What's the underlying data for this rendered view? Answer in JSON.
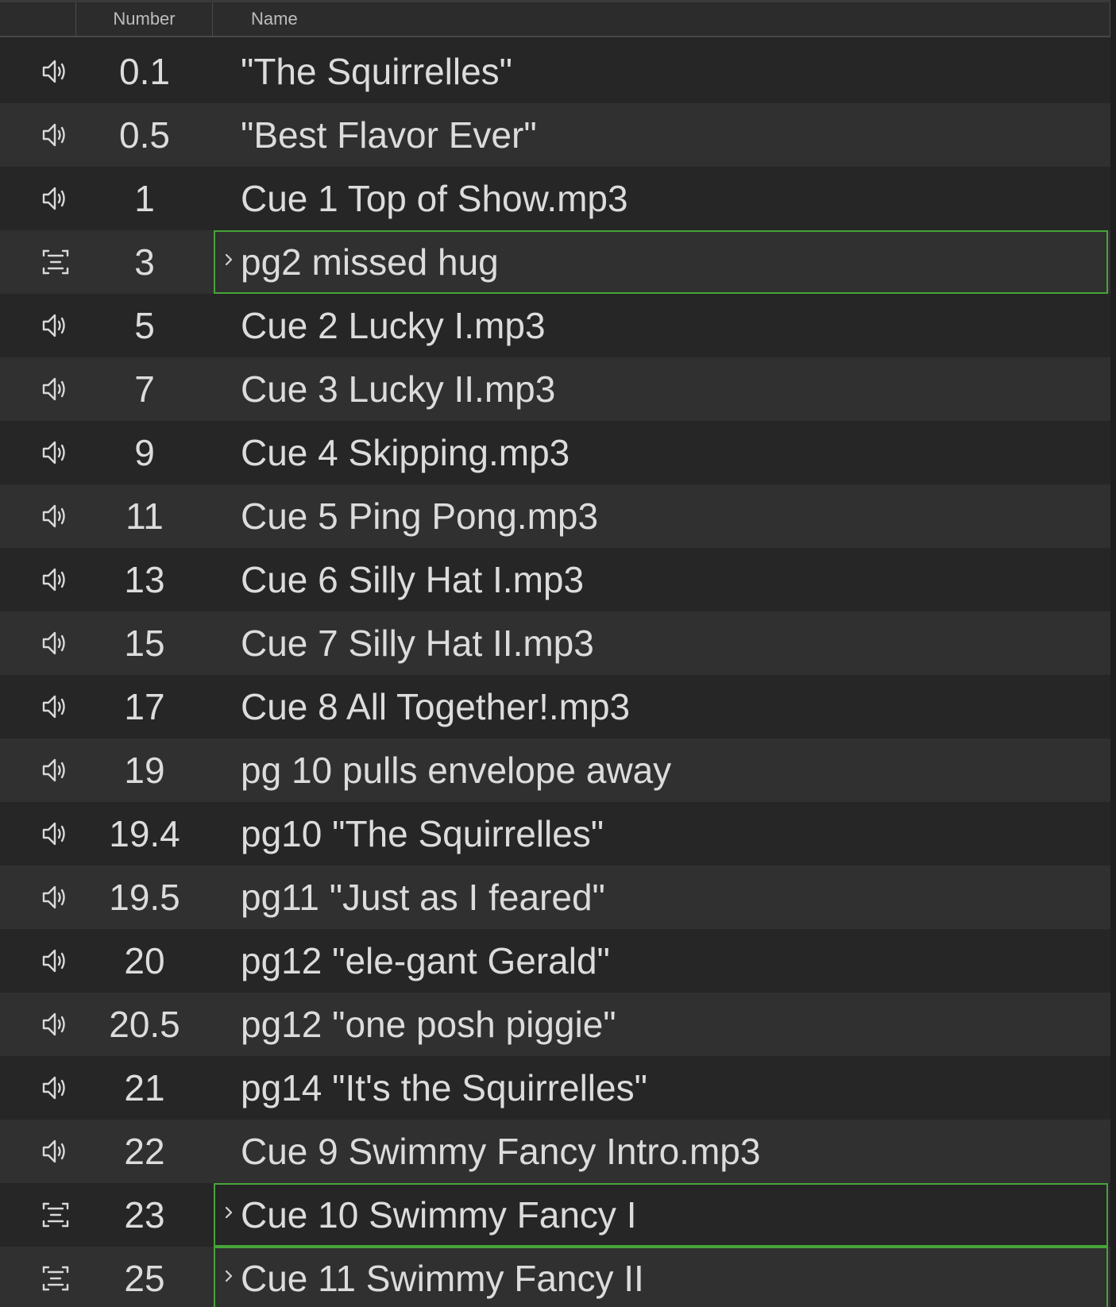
{
  "header": {
    "number_label": "Number",
    "name_label": "Name"
  },
  "colors": {
    "group_outline": "#47a33a",
    "row_dark": "#262626",
    "row_light": "#303030",
    "text": "#dcdcdc"
  },
  "cues": [
    {
      "type": "audio",
      "icon": "speaker-icon",
      "number": "0.1",
      "name": "\"The Squirrelles\""
    },
    {
      "type": "audio",
      "icon": "speaker-icon",
      "number": "0.5",
      "name": "\"Best Flavor Ever\""
    },
    {
      "type": "audio",
      "icon": "speaker-icon",
      "number": "1",
      "name": "Cue 1 Top of Show.mp3"
    },
    {
      "type": "group",
      "icon": "group-icon",
      "number": "3",
      "name": "pg2 missed hug"
    },
    {
      "type": "audio",
      "icon": "speaker-icon",
      "number": "5",
      "name": "Cue 2 Lucky I.mp3"
    },
    {
      "type": "audio",
      "icon": "speaker-icon",
      "number": "7",
      "name": "Cue 3 Lucky II.mp3"
    },
    {
      "type": "audio",
      "icon": "speaker-icon",
      "number": "9",
      "name": "Cue 4 Skipping.mp3"
    },
    {
      "type": "audio",
      "icon": "speaker-icon",
      "number": "11",
      "name": "Cue 5 Ping Pong.mp3"
    },
    {
      "type": "audio",
      "icon": "speaker-icon",
      "number": "13",
      "name": "Cue 6 Silly Hat I.mp3"
    },
    {
      "type": "audio",
      "icon": "speaker-icon",
      "number": "15",
      "name": "Cue 7 Silly Hat II.mp3"
    },
    {
      "type": "audio",
      "icon": "speaker-icon",
      "number": "17",
      "name": "Cue 8 All Together!.mp3"
    },
    {
      "type": "audio",
      "icon": "speaker-icon",
      "number": "19",
      "name": "pg 10 pulls envelope away"
    },
    {
      "type": "audio",
      "icon": "speaker-icon",
      "number": "19.4",
      "name": "pg10 \"The Squirrelles\""
    },
    {
      "type": "audio",
      "icon": "speaker-icon",
      "number": "19.5",
      "name": "pg11 \"Just as I feared\""
    },
    {
      "type": "audio",
      "icon": "speaker-icon",
      "number": "20",
      "name": "pg12 \"ele-gant Gerald\""
    },
    {
      "type": "audio",
      "icon": "speaker-icon",
      "number": "20.5",
      "name": "pg12 \"one posh piggie\""
    },
    {
      "type": "audio",
      "icon": "speaker-icon",
      "number": "21",
      "name": "pg14 \"It's the Squirrelles\""
    },
    {
      "type": "audio",
      "icon": "speaker-icon",
      "number": "22",
      "name": "Cue 9 Swimmy Fancy Intro.mp3"
    },
    {
      "type": "group",
      "icon": "group-icon",
      "number": "23",
      "name": "Cue 10 Swimmy Fancy I"
    },
    {
      "type": "group",
      "icon": "group-icon",
      "number": "25",
      "name": "Cue 11 Swimmy Fancy II"
    }
  ]
}
